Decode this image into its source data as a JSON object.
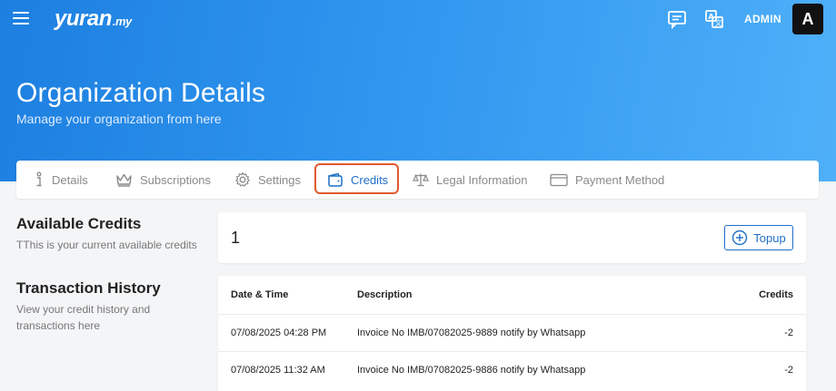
{
  "header": {
    "logo_main": "yuran",
    "logo_suffix": ".my",
    "user_label": "ADMIN",
    "avatar_initial": "A"
  },
  "page": {
    "title": "Organization Details",
    "subtitle": "Manage your organization from here"
  },
  "tabs": [
    {
      "label": "Details",
      "icon": "info-icon",
      "active": false
    },
    {
      "label": "Subscriptions",
      "icon": "crown-icon",
      "active": false
    },
    {
      "label": "Settings",
      "icon": "gear-icon",
      "active": false
    },
    {
      "label": "Credits",
      "icon": "wallet-icon",
      "active": true
    },
    {
      "label": "Legal Information",
      "icon": "scale-icon",
      "active": false
    },
    {
      "label": "Payment Method",
      "icon": "card-icon",
      "active": false
    }
  ],
  "available_credits": {
    "title": "Available Credits",
    "description": "TThis is your current available credits",
    "value": "1",
    "topup_label": "Topup"
  },
  "history": {
    "title": "Transaction History",
    "description": "View your credit history and transactions here",
    "columns": [
      "Date & Time",
      "Description",
      "Credits"
    ],
    "rows": [
      {
        "datetime": "07/08/2025 04:28 PM",
        "description": "Invoice No IMB/07082025-9889 notify by Whatsapp",
        "credits": "-2"
      },
      {
        "datetime": "07/08/2025 11:32 AM",
        "description": "Invoice No IMB/07082025-9886 notify by Whatsapp",
        "credits": "-2"
      }
    ]
  },
  "colors": {
    "accent": "#1f6fc8",
    "highlight": "#e2582f",
    "header_gradient_start": "#1d7fe0",
    "header_gradient_end": "#4fb0f9"
  }
}
